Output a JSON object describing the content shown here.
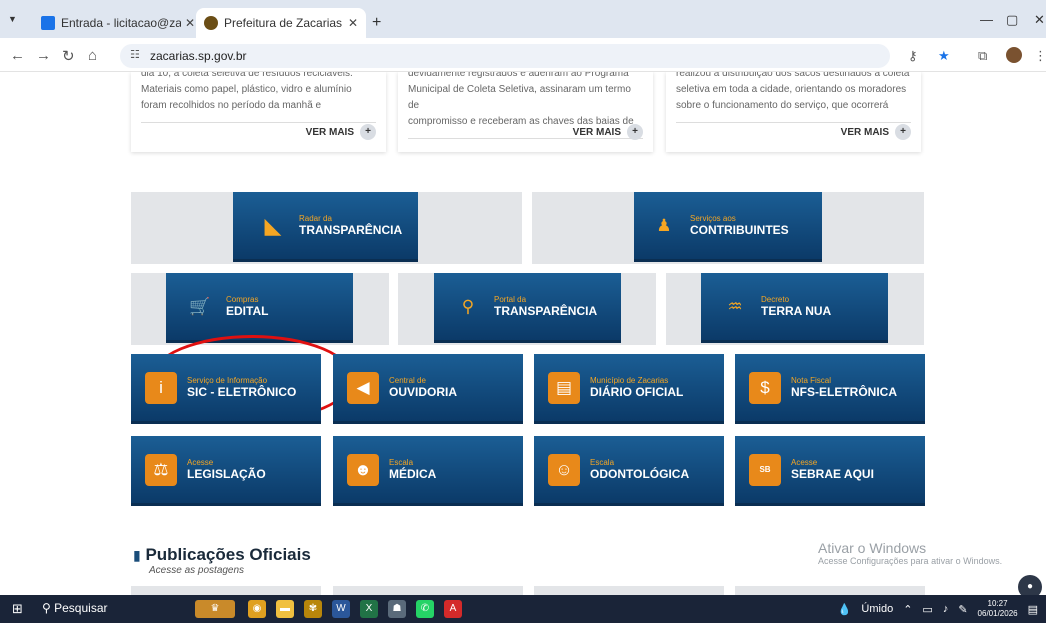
{
  "browser": {
    "tabs": [
      {
        "title": "Entrada - licitacao@zacarias.sp",
        "fav_color": "#1a73e8"
      },
      {
        "title": "Prefeitura de Zacarias - SP",
        "fav_color": "#6b4e16"
      }
    ],
    "url": "zacarias.sp.gov.br"
  },
  "cards": [
    {
      "lines": [
        "dia 10, a coleta seletiva de resíduos recicláveis.",
        "Materiais como papel, plástico, vidro e alumínio",
        "foram recolhidos no período da manhã e"
      ],
      "more": "VER MAIS"
    },
    {
      "lines": [
        "devidamente registrados e aderiram ao Programa",
        "Municipal de Coleta Seletiva, assinaram um termo de",
        "compromisso e receberam as chaves das baias de"
      ],
      "more": "VER MAIS"
    },
    {
      "lines": [
        "realizou a distribuição dos sacos destinados à coleta",
        "seletiva em toda a cidade, orientando os moradores",
        "sobre o funcionamento do serviço, que ocorrerá"
      ],
      "more": "VER MAIS"
    }
  ],
  "buttons": [
    {
      "small": "Radar da",
      "large": "TRANSPARÊNCIA",
      "icon": "rss-icon",
      "icon_color": "#f5a623"
    },
    {
      "small": "Serviços aos",
      "large": "CONTRIBUINTES",
      "icon": "people-chart-icon",
      "icon_color": "#f5a623"
    },
    {
      "small": "Compras",
      "large": "EDITAL",
      "icon": "cart-icon",
      "icon_color": "#f5a623"
    },
    {
      "small": "Portal da",
      "large": "TRANSPARÊNCIA",
      "icon": "search-icon",
      "icon_color": "#f5a623"
    },
    {
      "small": "Decreto",
      "large": "TERRA NUA",
      "icon": "land-icon",
      "icon_color": "#f5a623"
    },
    {
      "small": "Serviço de Informação",
      "large": "SIC - ELETRÔNICO",
      "icon": "info-icon",
      "icon_color": "#f5a623"
    },
    {
      "small": "Central de",
      "large": "OUVIDORIA",
      "icon": "megaphone-icon",
      "icon_color": "#f5a623"
    },
    {
      "small": "Município de Zacarias",
      "large": "DIÁRIO OFICIAL",
      "icon": "newspaper-icon",
      "icon_color": "#f5a623"
    },
    {
      "small": "Nota Fiscal",
      "large": "NFS-ELETRÔNICA",
      "icon": "invoice-icon",
      "icon_color": "#f5a623"
    },
    {
      "small": "Acesse",
      "large": "LEGISLAÇÃO",
      "icon": "scales-icon",
      "icon_color": "#f5a623"
    },
    {
      "small": "Escala",
      "large": "MÉDICA",
      "icon": "doctor-icon",
      "icon_color": "#f5a623"
    },
    {
      "small": "Escala",
      "large": "ODONTOLÓGICA",
      "icon": "dentist-icon",
      "icon_color": "#f5a623"
    },
    {
      "small": "Acesse",
      "large": "SEBRAE AQUI",
      "icon": "sebrae-icon",
      "icon_color": "#f5a623"
    }
  ],
  "publications": {
    "title": "Publicações Oficiais",
    "subtitle": "Acesse as postagens"
  },
  "watermark": {
    "title": "Ativar o Windows",
    "subtitle": "Acesse Configurações para ativar o Windows."
  },
  "taskbar": {
    "search": "Pesquisar",
    "weather": "Úmido",
    "time": "10:27",
    "date": "06/01/2026"
  }
}
